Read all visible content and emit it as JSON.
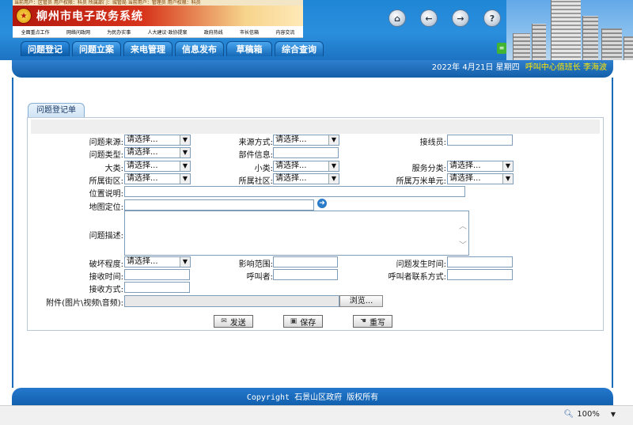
{
  "header": {
    "banner_top": "当前用户：区管员  用户权限：科员  所属部门：城管局  当前用户：管理员  用户权限：科员",
    "system_title": "柳州市电子政务系统",
    "banner_links": [
      "全面重点工作",
      "网络问政网",
      "为民办实事",
      "人大建议·政协提案",
      "政府热线",
      "市长信箱",
      "内容交流"
    ],
    "icons": [
      "home-icon",
      "back-icon",
      "forward-icon",
      "help-icon"
    ]
  },
  "tabs": [
    "问题登记",
    "问题立案",
    "来电管理",
    "信息发布",
    "草稿箱",
    "综合查询"
  ],
  "dateline": {
    "date": "2022年 4月21日 星期四",
    "duty_label": "呼叫中心值班长",
    "duty_name": "李海波"
  },
  "form": {
    "panel_title": "问题登记单",
    "select_placeholder": "请选择...",
    "labels": {
      "source": "问题来源:",
      "source_method": "来源方式:",
      "operator": "接线员:",
      "type": "问题类型:",
      "dept_info": "部件信息:",
      "big_class": "大类:",
      "small_class": "小类:",
      "service_class": "服务分类:",
      "street": "所属街区:",
      "community": "所属社区:",
      "grid": "所属万米单元:",
      "location": "位置说明:",
      "map": "地图定位:",
      "description": "问题描述:",
      "damage": "破坏程度:",
      "impact": "影响范围:",
      "occur_time": "问题发生时间:",
      "receive_time": "接收时间:",
      "caller": "呼叫者:",
      "caller_contact": "呼叫者联系方式:",
      "receive_method": "接收方式:",
      "attachment": "附件(图片\\视频\\音频):"
    },
    "browse_label": "浏览...",
    "buttons": {
      "send": "发送",
      "save": "保存",
      "rewrite": "重写"
    }
  },
  "footer": {
    "copyright": "Copyright 石景山区政府 版权所有"
  },
  "statusbar": {
    "zoom": "100%"
  }
}
